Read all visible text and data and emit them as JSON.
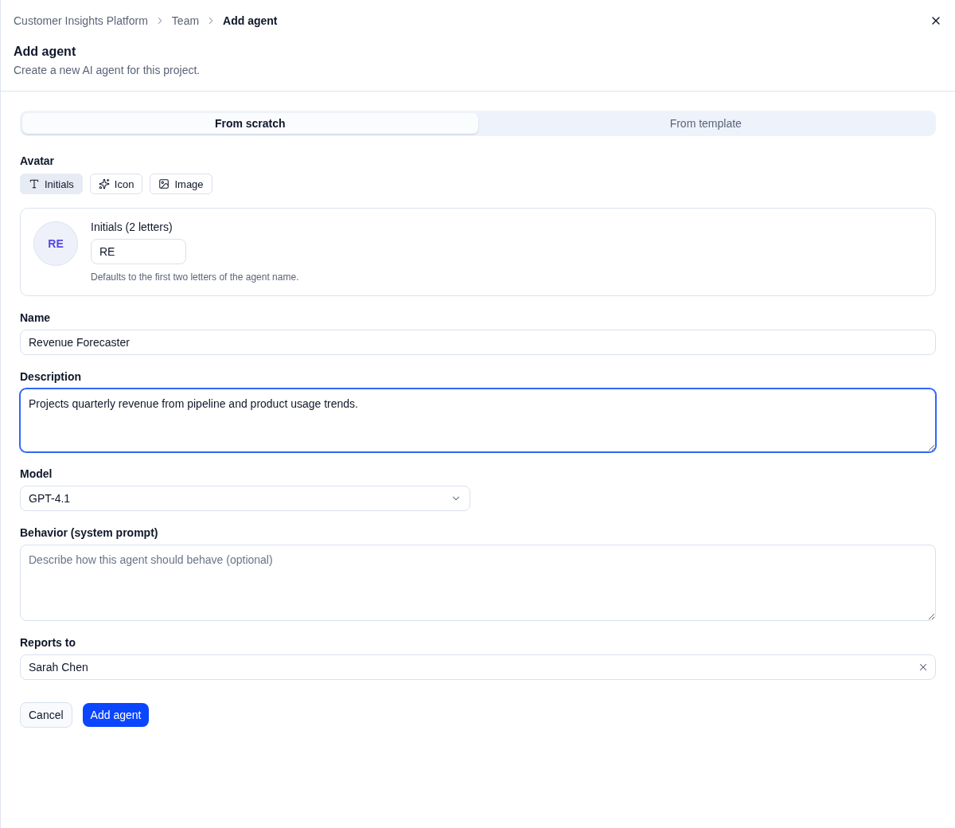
{
  "breadcrumb": [
    {
      "label": "Customer Insights Platform",
      "current": false
    },
    {
      "label": "Team",
      "current": false
    },
    {
      "label": "Add agent",
      "current": true
    }
  ],
  "header": {
    "title": "Add agent",
    "subtitle": "Create a new AI agent for this project."
  },
  "mode_tabs": [
    {
      "label": "From scratch",
      "selected": true
    },
    {
      "label": "From template",
      "selected": false
    }
  ],
  "avatar": {
    "label": "Avatar",
    "types": [
      {
        "kind": "initials",
        "label": "Initials",
        "selected": true
      },
      {
        "kind": "icon",
        "label": "Icon",
        "selected": false
      },
      {
        "kind": "image",
        "label": "Image",
        "selected": false
      }
    ],
    "preview": "RE",
    "initials_label": "Initials (2 letters)",
    "initials_value": "RE",
    "hint": "Defaults to the first two letters of the agent name."
  },
  "name": {
    "label": "Name",
    "value": "Revenue Forecaster",
    "focused": false
  },
  "description": {
    "label": "Description",
    "value": "Projects quarterly revenue from pipeline and product usage trends.",
    "focused": true
  },
  "model": {
    "label": "Model",
    "value": "GPT-4.1",
    "focused": false
  },
  "behavior": {
    "label": "Behavior (system prompt)",
    "placeholder": "Describe how this agent should behave (optional)",
    "focused": false
  },
  "reports_to": {
    "label": "Reports to",
    "value": "Sarah Chen",
    "focused": false
  },
  "actions": [
    {
      "kind": "secondary",
      "label": "Cancel"
    },
    {
      "kind": "primary",
      "label": "Add agent"
    }
  ]
}
